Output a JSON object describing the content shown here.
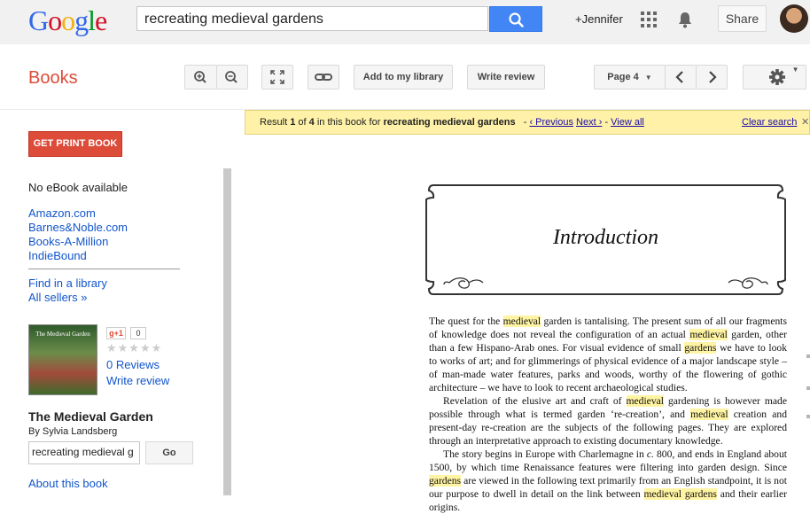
{
  "header": {
    "logo_letters": [
      {
        "ch": "G",
        "cls": "b"
      },
      {
        "ch": "o",
        "cls": "r"
      },
      {
        "ch": "o",
        "cls": "y"
      },
      {
        "ch": "g",
        "cls": "b"
      },
      {
        "ch": "l",
        "cls": "g"
      },
      {
        "ch": "e",
        "cls": "r"
      }
    ],
    "search_value": "recreating medieval gardens",
    "user_link": "+Jennifer",
    "share_label": "Share"
  },
  "toolbar": {
    "section_title": "Books",
    "add_library_label": "Add to my library",
    "write_review_label": "Write review",
    "page_label": "Page 4"
  },
  "result_bar": {
    "prefix": "Result ",
    "current": "1",
    "of": " of ",
    "total": "4",
    "mid": " in this book for ",
    "query": "recreating medieval gardens",
    "previous": "‹ Previous",
    "next": "Next ›",
    "view_all": "View all",
    "clear": "Clear search"
  },
  "sidebar": {
    "get_print_label": "GET PRINT BOOK",
    "no_ebook": "No eBook available",
    "sellers": [
      "Amazon.com",
      "Barnes&Noble.com",
      "Books-A-Million",
      "IndieBound"
    ],
    "find_library": "Find in a library",
    "all_sellers": "All sellers »",
    "gplus_label": "g+1",
    "gplus_count": "0",
    "reviews": "0 Reviews",
    "write_review": "Write review",
    "book_title": "The Medieval Garden",
    "book_author": "By Sylvia Landsberg",
    "inbook_search_value": "recreating medieval g",
    "go_label": "Go",
    "about": "About this book",
    "cover_text": "The Medieval Garden"
  },
  "page": {
    "heading": "Introduction",
    "paragraphs": [
      [
        {
          "t": "The quest for the "
        },
        {
          "t": "medieval",
          "h": true
        },
        {
          "t": " garden is tantalising. The present sum of all our fragments of knowledge does not reveal the configuration of an actual "
        },
        {
          "t": "medieval",
          "h": true
        },
        {
          "t": " garden, other than a few Hispano-Arab ones. For visual evidence of small "
        },
        {
          "t": "gardens",
          "h": true
        },
        {
          "t": " we have to look to works of art; and for glimmerings of physical evidence of a major landscape style – of man-made water features, parks and woods, worthy of the flowering of gothic architecture – we have to look to recent archaeological studies."
        }
      ],
      [
        {
          "t": "Revelation of the elusive art and craft of "
        },
        {
          "t": "medieval",
          "h": true
        },
        {
          "t": " gardening is however made possible through what is termed garden ‘re-creation’, and "
        },
        {
          "t": "medieval",
          "h": true
        },
        {
          "t": " creation and present-day re-creation are the subjects of the following pages. They are explored through an interpretative approach to existing documentary knowledge."
        }
      ],
      [
        {
          "t": "The story begins in Europe with Charlemagne in "
        },
        {
          "t": "c.",
          "i": true
        },
        {
          "t": " 800, and ends in England about 1500, by which time Renaissance features were filtering into garden design. Since "
        },
        {
          "t": "gardens",
          "h": true
        },
        {
          "t": " are viewed in the following text primarily from an English standpoint, it is not our purpose to dwell in detail on the link between "
        },
        {
          "t": "medieval gardens",
          "h": true
        },
        {
          "t": " and their earlier origins."
        }
      ]
    ]
  }
}
